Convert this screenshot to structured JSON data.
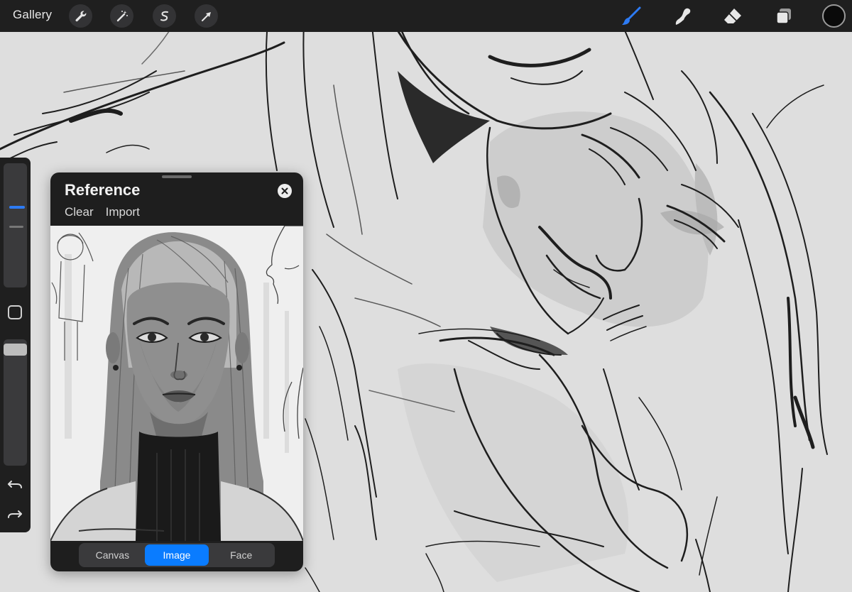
{
  "topbar": {
    "gallery_label": "Gallery",
    "left_tools": [
      "wrench-icon",
      "magic-wand-icon",
      "selection-icon",
      "transform-arrow-icon"
    ],
    "right_tools": [
      "brush-icon",
      "smudge-icon",
      "eraser-icon",
      "layers-icon"
    ],
    "active_tool": "brush",
    "accent_color": "#2d7bf4",
    "current_color": "#0a0a0a"
  },
  "sidebar": {
    "tools": [
      "brush-size-slider",
      "modify-button",
      "opacity-slider",
      "undo-icon",
      "redo-icon"
    ]
  },
  "reference": {
    "title": "Reference",
    "actions": {
      "clear": "Clear",
      "import": "Import"
    },
    "tabs": [
      "Canvas",
      "Image",
      "Face"
    ],
    "active_tab": "Image"
  }
}
